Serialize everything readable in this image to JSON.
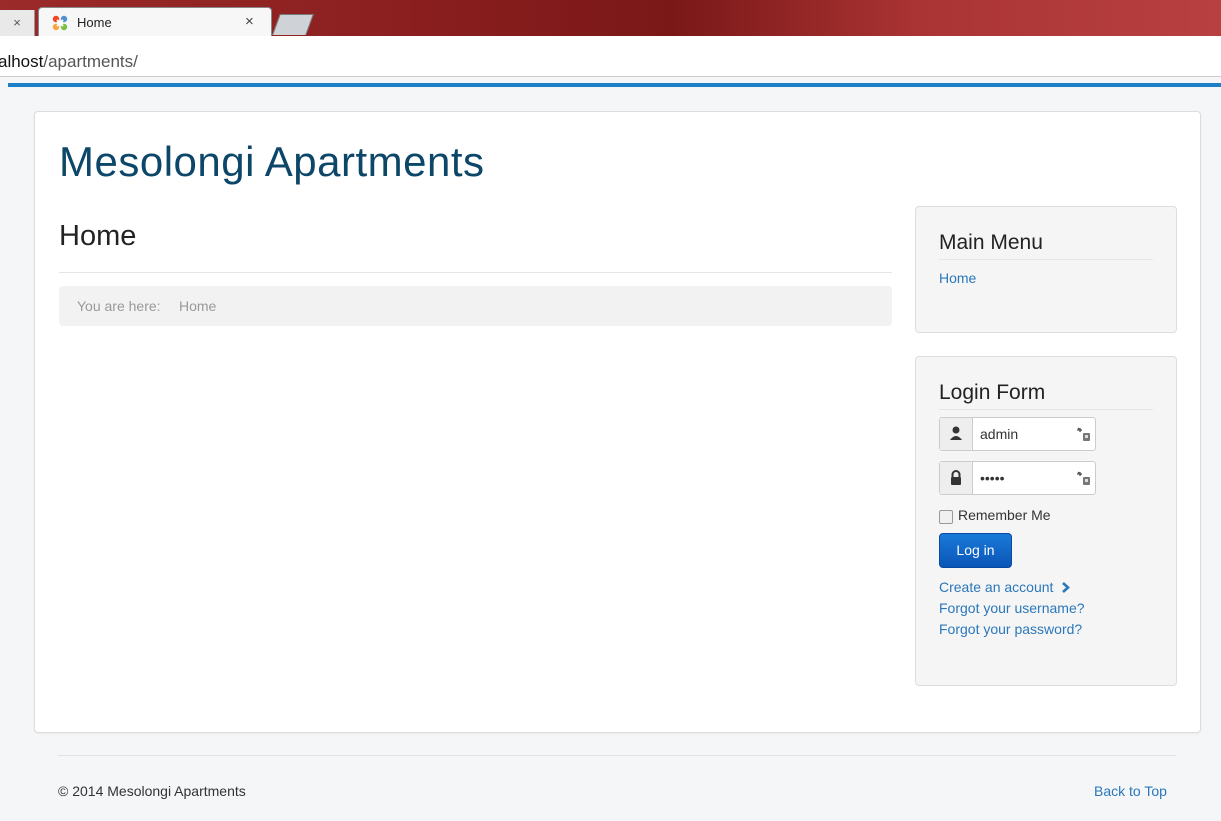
{
  "browser": {
    "prev_tab_close": "×",
    "tab_title": "Home",
    "tab_close": "×",
    "url_host": "alhost",
    "url_path": "/apartments/"
  },
  "site": {
    "title": "Mesolongi Apartments"
  },
  "page": {
    "heading": "Home",
    "breadcrumb_prefix": "You are here:",
    "breadcrumb_current": "Home"
  },
  "main_menu": {
    "title": "Main Menu",
    "items": [
      {
        "label": "Home"
      }
    ]
  },
  "login": {
    "title": "Login Form",
    "username_value": "admin",
    "password_value": "•••••",
    "remember_label": "Remember Me",
    "login_label": "Log in",
    "create_account": "Create an account",
    "forgot_username": "Forgot your username?",
    "forgot_password": "Forgot your password?"
  },
  "footer": {
    "copyright": "© 2014 Mesolongi Apartments",
    "back_to_top": "Back to Top"
  },
  "colors": {
    "link": "#2a77bb",
    "site_title": "#0c4669",
    "accent_bar": "#1e7ec6",
    "button": "#0a55b8"
  },
  "icons": [
    "joomla-icon",
    "user-icon",
    "lock-icon",
    "key-icon",
    "chevron-right-icon"
  ]
}
